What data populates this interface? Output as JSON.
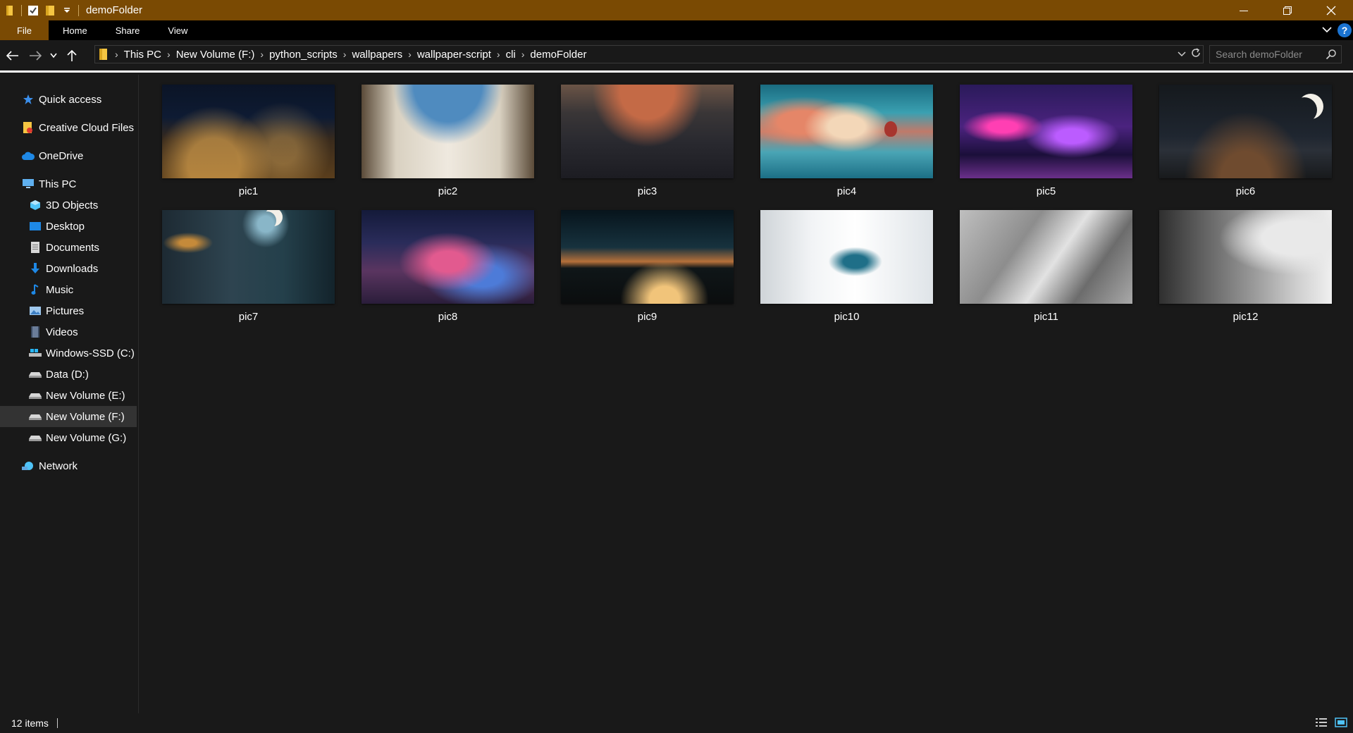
{
  "window": {
    "title": "demoFolder"
  },
  "ribbon": {
    "tabs": [
      "File",
      "Home",
      "Share",
      "View"
    ]
  },
  "address": {
    "crumbs": [
      "This PC",
      "New Volume (F:)",
      "python_scripts",
      "wallpapers",
      "wallpaper-script",
      "cli",
      "demoFolder"
    ]
  },
  "search": {
    "placeholder": "Search demoFolder"
  },
  "sidebar": {
    "quick_access": "Quick access",
    "creative_cloud": "Creative Cloud Files",
    "onedrive": "OneDrive",
    "this_pc": "This PC",
    "pc_items": [
      "3D Objects",
      "Desktop",
      "Documents",
      "Downloads",
      "Music",
      "Pictures",
      "Videos",
      "Windows-SSD (C:)",
      "Data (D:)",
      "New Volume (E:)",
      "New Volume (F:)",
      "New Volume (G:)"
    ],
    "network": "Network",
    "selected": "New Volume (F:)"
  },
  "files": [
    {
      "name": "pic1"
    },
    {
      "name": "pic2"
    },
    {
      "name": "pic3"
    },
    {
      "name": "pic4"
    },
    {
      "name": "pic5"
    },
    {
      "name": "pic6"
    },
    {
      "name": "pic7"
    },
    {
      "name": "pic8"
    },
    {
      "name": "pic9"
    },
    {
      "name": "pic10"
    },
    {
      "name": "pic11"
    },
    {
      "name": "pic12"
    }
  ],
  "status": {
    "count": "12 items"
  },
  "colors": {
    "titlebar": "#7a4a03",
    "background": "#191919",
    "selection": "#333333"
  }
}
